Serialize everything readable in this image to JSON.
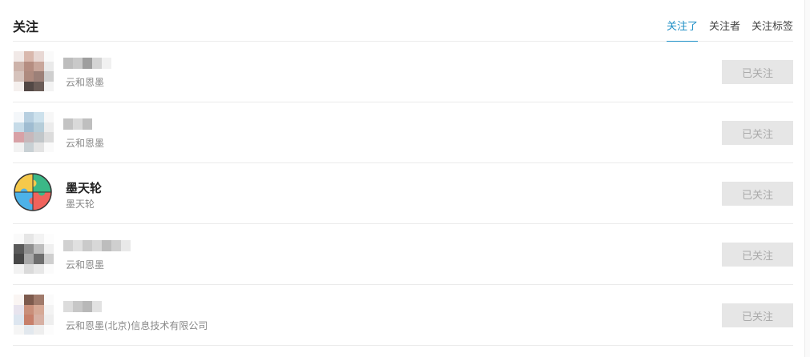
{
  "header": {
    "title": "关注",
    "tabs": [
      {
        "label": "关注了",
        "active": true
      },
      {
        "label": "关注者",
        "active": false
      },
      {
        "label": "关注标签",
        "active": false
      }
    ]
  },
  "follow_button_label": "已关注",
  "users": [
    {
      "name": "",
      "desc": "云和恩墨",
      "avatar": "pixelated-photo"
    },
    {
      "name": "",
      "desc": "云和恩墨",
      "avatar": "pixelated-photo"
    },
    {
      "name": "墨天轮",
      "desc": "墨天轮",
      "avatar": "puzzle-logo"
    },
    {
      "name": "",
      "desc": "云和恩墨",
      "avatar": "pixelated-photo"
    },
    {
      "name": "",
      "desc": "云和恩墨(北京)信息技术有限公司",
      "avatar": "pixelated-photo"
    }
  ],
  "colors": {
    "accent": "#1f8fc6",
    "button_bg": "#e6e6e6",
    "button_text": "#aaaaaa"
  }
}
